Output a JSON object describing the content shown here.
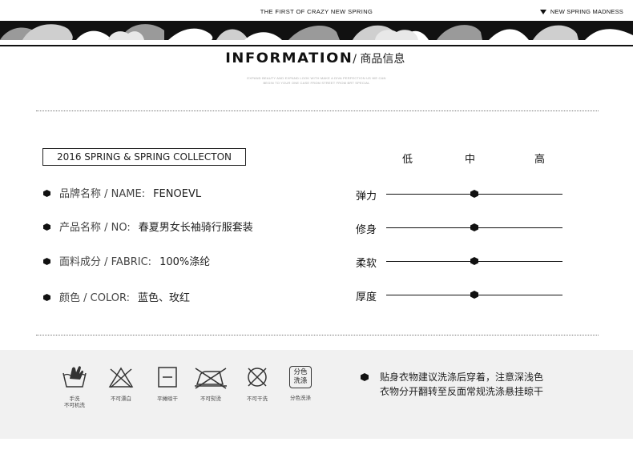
{
  "header": {
    "tagline": "THE FIRST OF CRAZY NEW SPRING",
    "right_label": "NEW SPRING MADNESS"
  },
  "section": {
    "title_en": "INFORMATION",
    "title_cn": "/ 商品信息",
    "subtitle_line1": "EXPAND BEAUTY AND EXPAND LOOK WITH MAKE A DIVA PERFECTION US WE CAN",
    "subtitle_line2": "BEGIN TO YOUR ONE CASE FROM STREET FROM BRT SPECIAL"
  },
  "series_label": "2016 SPRING & SPRING COLLECTON",
  "attributes": [
    {
      "label": "品牌名称 / NAME:",
      "value": "FENOEVL"
    },
    {
      "label": "产品名称 / NO:",
      "value": "春夏男女长袖骑行服套装"
    },
    {
      "label": "面料成分 / FABRIC:",
      "value": "100%涤纶"
    },
    {
      "label": "颜色 / COLOR:",
      "value": "蓝色、玫红"
    }
  ],
  "scale_levels": [
    "低",
    "中",
    "高"
  ],
  "ratings": [
    {
      "name": "弹力",
      "level": 0.5
    },
    {
      "name": "修身",
      "level": 0.5
    },
    {
      "name": "柔软",
      "level": 0.5
    },
    {
      "name": "厚度",
      "level": 0.5
    }
  ],
  "care": {
    "icons": [
      {
        "icon": "hand-wash-icon",
        "label_line1": "手洗",
        "label_line2": "不可机洗"
      },
      {
        "icon": "no-bleach-icon",
        "label_line1": "不可漂白",
        "label_line2": ""
      },
      {
        "icon": "dry-flat-icon",
        "label_line1": "平摊晾干",
        "label_line2": ""
      },
      {
        "icon": "no-iron-icon",
        "label_line1": "不可熨烫",
        "label_line2": ""
      },
      {
        "icon": "no-dry-clean-icon",
        "label_line1": "不可干洗",
        "label_line2": ""
      },
      {
        "icon": "wash-separately-icon",
        "label_line1": "分色洗涤",
        "label_line2": "",
        "badge_line1": "分色",
        "badge_line2": "洗涤"
      }
    ],
    "note_line1": "贴身衣物建议洗涤后穿着，注意深浅色",
    "note_line2": "衣物分开翻转至反面常规洗涤悬挂晾干"
  },
  "colors": {
    "ink": "#111111",
    "care_bg": "#f1f1f1",
    "muted": "#444444"
  }
}
